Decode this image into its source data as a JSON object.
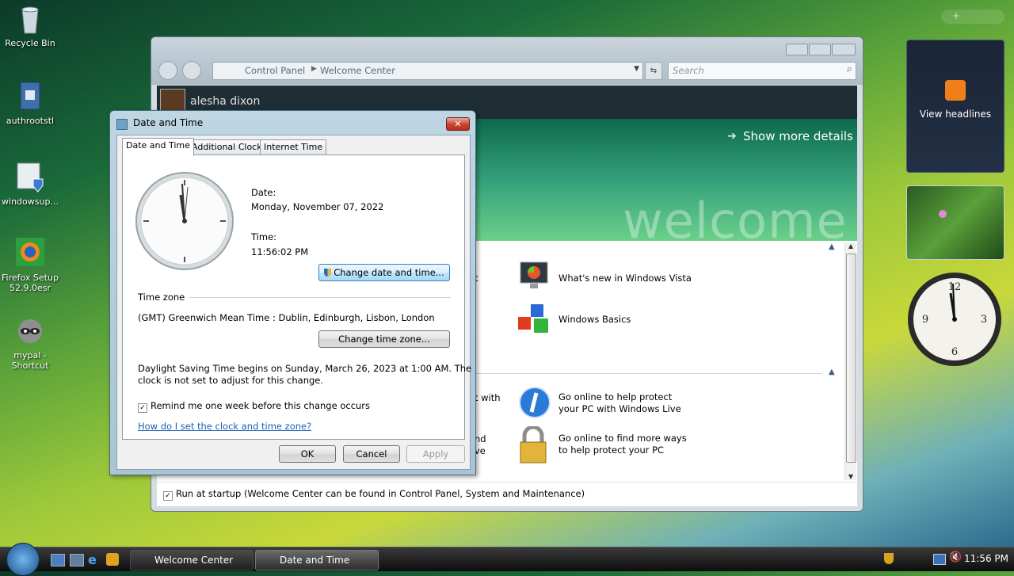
{
  "desktop": {
    "icons": [
      {
        "label": "Recycle Bin",
        "icon": "recycle-bin-icon"
      },
      {
        "label": "authrootstl",
        "icon": "file-icon"
      },
      {
        "label": "windowsup...",
        "icon": "shield-file-icon"
      },
      {
        "label": "Firefox Setup 52.9.0esr",
        "icon": "firefox-icon"
      },
      {
        "label": "mypal - Shortcut",
        "icon": "raccoon-icon"
      }
    ]
  },
  "background_window": {
    "breadcrumb": [
      "Control Panel",
      "Welcome Center"
    ],
    "search_placeholder": "Search",
    "user_name": "alesha dixon",
    "show_more": "Show more details",
    "banner_word": "welcome",
    "items": [
      {
        "label": "What's new in Windows Vista",
        "icon": "monitor-icon"
      },
      {
        "label": "Windows Basics",
        "icon": "cubes-icon"
      },
      {
        "label": "Go online to help protect your PC with Windows Live",
        "icon": "windows-live-icon"
      },
      {
        "label": "Go online to find more ways to help protect your PC",
        "icon": "lock-icon"
      }
    ],
    "clipped_text": [
      "t",
      "t with",
      "nd",
      "ve"
    ],
    "run_at_startup": "Run at startup (Welcome Center can be found in Control Panel, System and Maintenance)"
  },
  "dialog": {
    "title": "Date and Time",
    "tabs": [
      "Date and Time",
      "Additional Clocks",
      "Internet Time"
    ],
    "date_label": "Date:",
    "date_value": "Monday, November 07, 2022",
    "time_label": "Time:",
    "time_value": "11:56:02 PM",
    "change_datetime": "Change date and time...",
    "timezone_heading": "Time zone",
    "timezone_value": "(GMT) Greenwich Mean Time : Dublin, Edinburgh, Lisbon, London",
    "change_timezone": "Change time zone...",
    "dst_text_1": "Daylight Saving Time begins on Sunday, March 26, 2023 at 1:00 AM. The",
    "dst_text_2": "clock is not set to adjust for this change.",
    "remind": "Remind me one week before this change occurs",
    "help_link": "How do I set the clock and time zone?",
    "ok": "OK",
    "cancel": "Cancel",
    "apply": "Apply"
  },
  "sidebar": {
    "feed_label": "View headlines"
  },
  "taskbar": {
    "tasks": [
      "Welcome Center",
      "Date and Time"
    ],
    "clock": "11:56 PM"
  }
}
